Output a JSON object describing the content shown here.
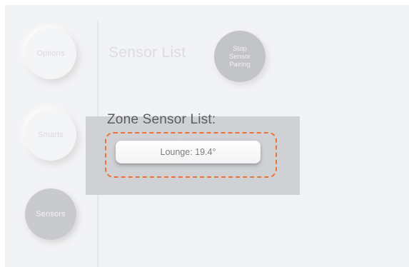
{
  "nav": {
    "options_label": "Options",
    "smarts_label": "Smarts",
    "sensors_label": "Sensors"
  },
  "header": {
    "title": "Sensor List",
    "stop_pairing_label": "Stop Sensor Pairing"
  },
  "zone": {
    "title": "Zone Sensor List:",
    "sensors": [
      {
        "label": "Lounge: 19.4°"
      }
    ]
  },
  "colors": {
    "highlight": "#e9743a",
    "active_nav": "#c9cacd",
    "background": "#f2f3f5"
  }
}
